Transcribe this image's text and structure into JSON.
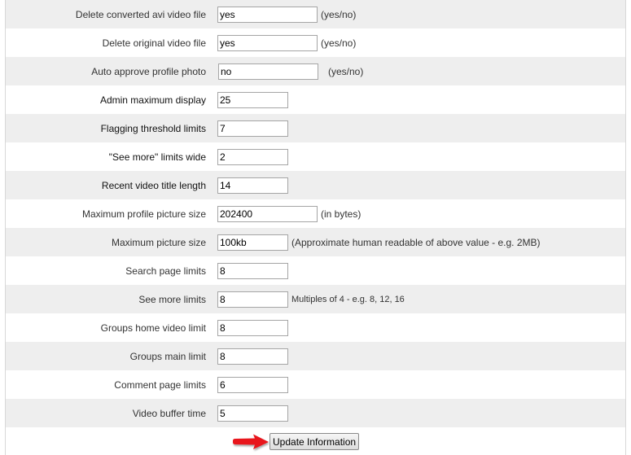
{
  "settings": {
    "rows": [
      {
        "label": "Delete converted avi video file",
        "value": "yes",
        "hint": "(yes/no)"
      },
      {
        "label": "Delete original video file",
        "value": "yes",
        "hint": "(yes/no)"
      },
      {
        "label": "Auto approve profile photo",
        "value": "no",
        "hint": "(yes/no)"
      },
      {
        "label": "Admin maximum display",
        "value": "25",
        "hint": ""
      },
      {
        "label": "Flagging threshold limits",
        "value": "7",
        "hint": ""
      },
      {
        "label": "\"See more\" limits wide",
        "value": "2",
        "hint": ""
      },
      {
        "label": "Recent video title length",
        "value": "14",
        "hint": ""
      },
      {
        "label": "Maximum profile picture size",
        "value": "202400",
        "hint": "(in bytes)"
      },
      {
        "label": "Maximum picture size",
        "value": "100kb",
        "hint": "(Approximate human readable of above value - e.g. 2MB)"
      },
      {
        "label": "Search page limits",
        "value": "8",
        "hint": ""
      },
      {
        "label": "See more limits",
        "value": "8",
        "hint": "Multiples of 4 - e.g. 8, 12, 16"
      },
      {
        "label": "Groups home video limit",
        "value": "8",
        "hint": ""
      },
      {
        "label": "Groups main limit",
        "value": "8",
        "hint": ""
      },
      {
        "label": "Comment page limits",
        "value": "6",
        "hint": ""
      },
      {
        "label": "Video buffer time",
        "value": "5",
        "hint": ""
      }
    ]
  },
  "submit": {
    "label": "Update Information"
  },
  "annotation": {
    "arrow_color": "#e8141b"
  }
}
